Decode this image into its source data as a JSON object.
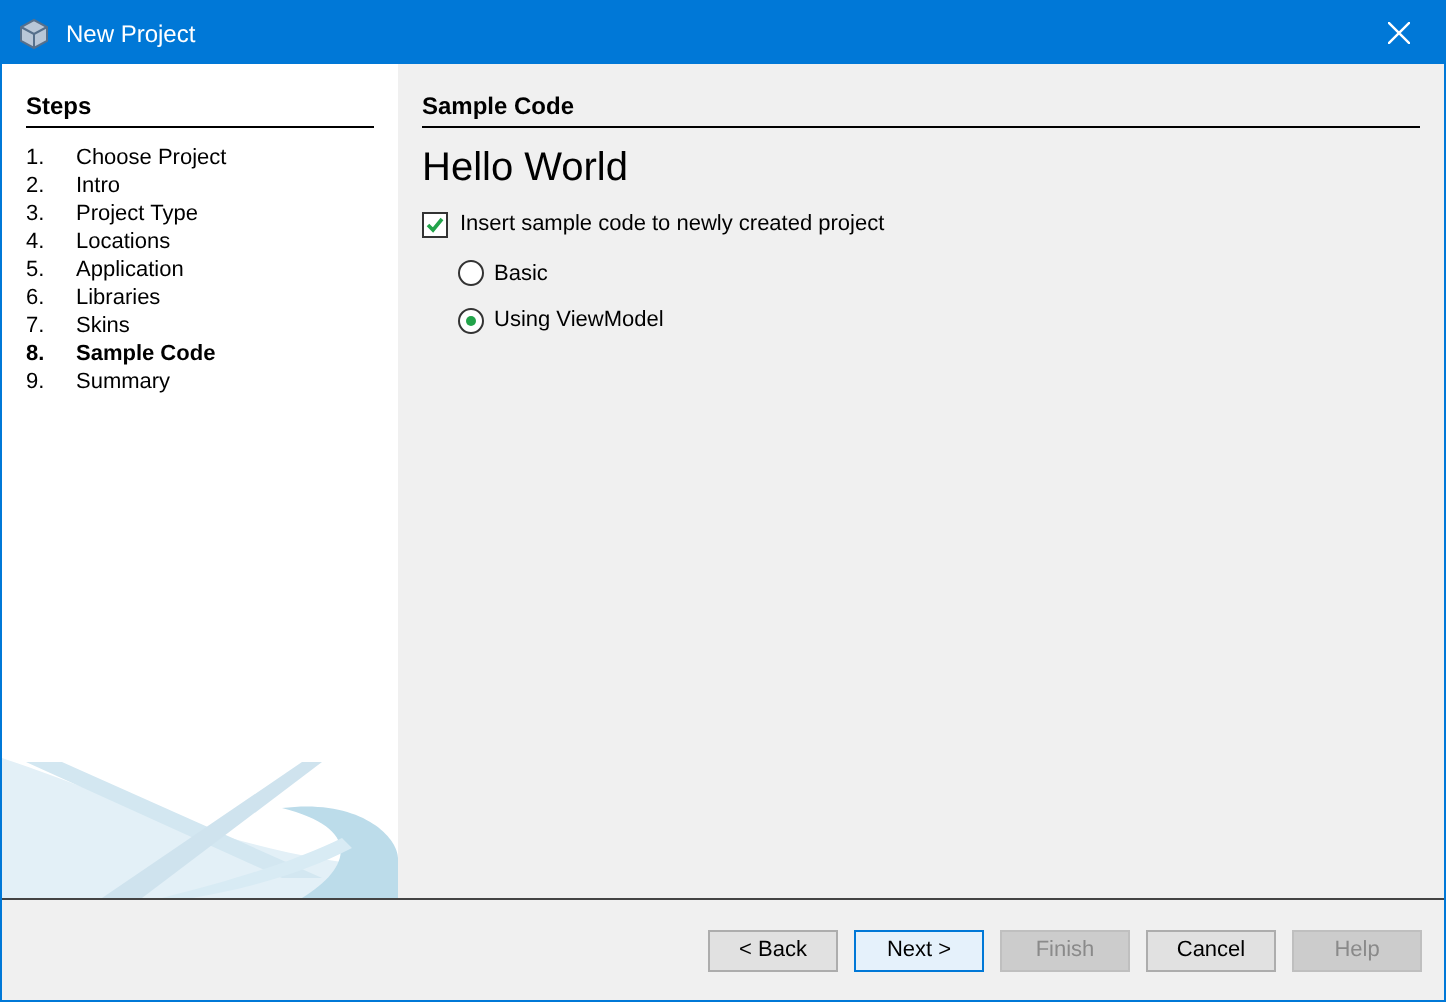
{
  "window": {
    "title": "New Project"
  },
  "steps": {
    "title": "Steps",
    "items": [
      {
        "number": "1.",
        "label": "Choose Project",
        "selected": false
      },
      {
        "number": "2.",
        "label": "Intro",
        "selected": false
      },
      {
        "number": "3.",
        "label": "Project Type",
        "selected": false
      },
      {
        "number": "4.",
        "label": "Locations",
        "selected": false
      },
      {
        "number": "5.",
        "label": "Application",
        "selected": false
      },
      {
        "number": "6.",
        "label": "Libraries",
        "selected": false
      },
      {
        "number": "7.",
        "label": "Skins",
        "selected": false
      },
      {
        "number": "8.",
        "label": "Sample Code",
        "selected": true
      },
      {
        "number": "9.",
        "label": "Summary",
        "selected": false
      }
    ]
  },
  "content": {
    "section_title": "Sample Code",
    "heading": "Hello World",
    "checkbox": {
      "label": "Insert sample code to newly created project",
      "checked": true
    },
    "options": [
      {
        "label": "Basic",
        "selected": false
      },
      {
        "label": "Using ViewModel",
        "selected": true
      }
    ]
  },
  "buttons": [
    {
      "label": "< Back",
      "disabled": false,
      "focused": false
    },
    {
      "label": "Next >",
      "disabled": false,
      "focused": true
    },
    {
      "label": "Finish",
      "disabled": true,
      "focused": false
    },
    {
      "label": "Cancel",
      "disabled": false,
      "focused": false
    },
    {
      "label": "Help",
      "disabled": true,
      "focused": false
    }
  ]
}
